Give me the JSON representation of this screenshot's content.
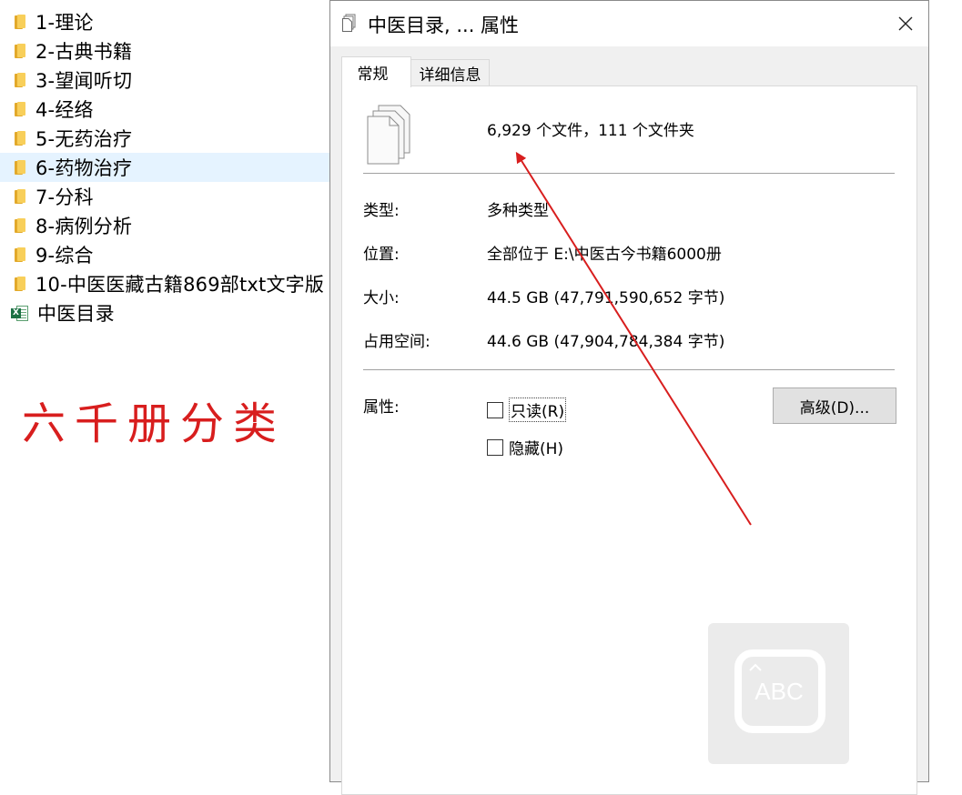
{
  "file_list": {
    "items": [
      {
        "label": "1-理论"
      },
      {
        "label": "2-古典书籍"
      },
      {
        "label": "3-望闻听切"
      },
      {
        "label": "4-经络"
      },
      {
        "label": "5-无药治疗"
      },
      {
        "label": "6-药物治疗"
      },
      {
        "label": "7-分科"
      },
      {
        "label": "8-病例分析"
      },
      {
        "label": "9-综合"
      },
      {
        "label": "10-中医医藏古籍869部txt文字版"
      }
    ],
    "excel_file": {
      "label": "中医目录",
      "badge": "X"
    }
  },
  "annotation": {
    "text": "六千册分类",
    "color": "#d81e1e"
  },
  "dialog": {
    "title": "中医目录, ... 属性",
    "tabs": {
      "general": "常规",
      "details": "详细信息"
    },
    "summary": "6,929 个文件，111 个文件夹",
    "properties": {
      "type": {
        "label": "类型:",
        "value": "多种类型"
      },
      "location": {
        "label": "位置:",
        "value": "全部位于 E:\\中医古今书籍6000册"
      },
      "size": {
        "label": "大小:",
        "value": "44.5 GB (47,791,590,652 字节)"
      },
      "size_on_disk": {
        "label": "占用空间:",
        "value": "44.6 GB (47,904,784,384 字节)"
      }
    },
    "attributes": {
      "label": "属性:",
      "readonly": {
        "label": "只读(R)",
        "checked": false
      },
      "hidden": {
        "label": "隐藏(H)",
        "checked": false
      },
      "advanced_button": "高级(D)..."
    }
  },
  "watermark": {
    "text": "ABC"
  },
  "colors": {
    "selection": "#e5f3ff",
    "folder": "#f8cf5a",
    "arrow": "#d81e1e"
  }
}
